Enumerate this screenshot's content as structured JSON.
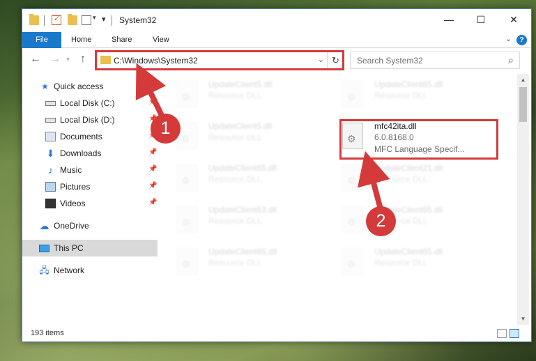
{
  "window": {
    "title": "System32"
  },
  "ribbon": {
    "tabs": [
      "File",
      "Home",
      "Share",
      "View"
    ]
  },
  "address": {
    "path": "C:\\Windows\\System32"
  },
  "search": {
    "placeholder": "Search System32"
  },
  "nav": {
    "items": [
      {
        "label": "Quick access",
        "icon": "star-icon",
        "pinned": false
      },
      {
        "label": "Local Disk (C:)",
        "icon": "drive-icon",
        "pinned": true
      },
      {
        "label": "Local Disk (D:)",
        "icon": "drive-icon",
        "pinned": true
      },
      {
        "label": "Documents",
        "icon": "documents-icon",
        "pinned": true
      },
      {
        "label": "Downloads",
        "icon": "download-icon",
        "pinned": true
      },
      {
        "label": "Music",
        "icon": "music-icon",
        "pinned": true
      },
      {
        "label": "Pictures",
        "icon": "pictures-icon",
        "pinned": true
      },
      {
        "label": "Videos",
        "icon": "videos-icon",
        "pinned": true
      },
      {
        "label": "OneDrive",
        "icon": "cloud-icon",
        "pinned": false
      },
      {
        "label": "This PC",
        "icon": "computer-icon",
        "pinned": false,
        "selected": true
      },
      {
        "label": "Network",
        "icon": "network-icon",
        "pinned": false
      }
    ]
  },
  "files": [
    {
      "name": "UpdateClient5.dll",
      "desc": "Resource DLL",
      "blurred": true
    },
    {
      "name": "UpdateClient65.dll",
      "desc": "Resource DLL",
      "blurred": true
    },
    {
      "name": "UpdateClient5.dll",
      "desc": "Resource DLL",
      "blurred": true
    },
    {
      "name": "mfc42ita.dll",
      "version": "6.0.8168.0",
      "desc": "MFC Language Specif...",
      "blurred": false,
      "highlighted": true
    },
    {
      "name": "UpdateClient65.dll",
      "desc": "Resource DLL",
      "blurred": true
    },
    {
      "name": "UpdateClient21.dll",
      "desc": "Resource DLL",
      "blurred": true
    },
    {
      "name": "UpdateClient63.dll",
      "desc": "Resource DLL",
      "blurred": true
    },
    {
      "name": "UpdateClient65.dll",
      "desc": "Resource DLL",
      "blurred": true
    },
    {
      "name": "UpdateClient65.dll",
      "desc": "Resource DLL",
      "blurred": true
    },
    {
      "name": "UpdateClient65.dll",
      "desc": "Resource DLL",
      "blurred": true
    }
  ],
  "status": {
    "item_count": "193 items"
  },
  "callouts": [
    "1",
    "2"
  ],
  "colors": {
    "accent": "#1979ca",
    "callout": "#d43a3a",
    "selected": "#d9d9d9"
  }
}
